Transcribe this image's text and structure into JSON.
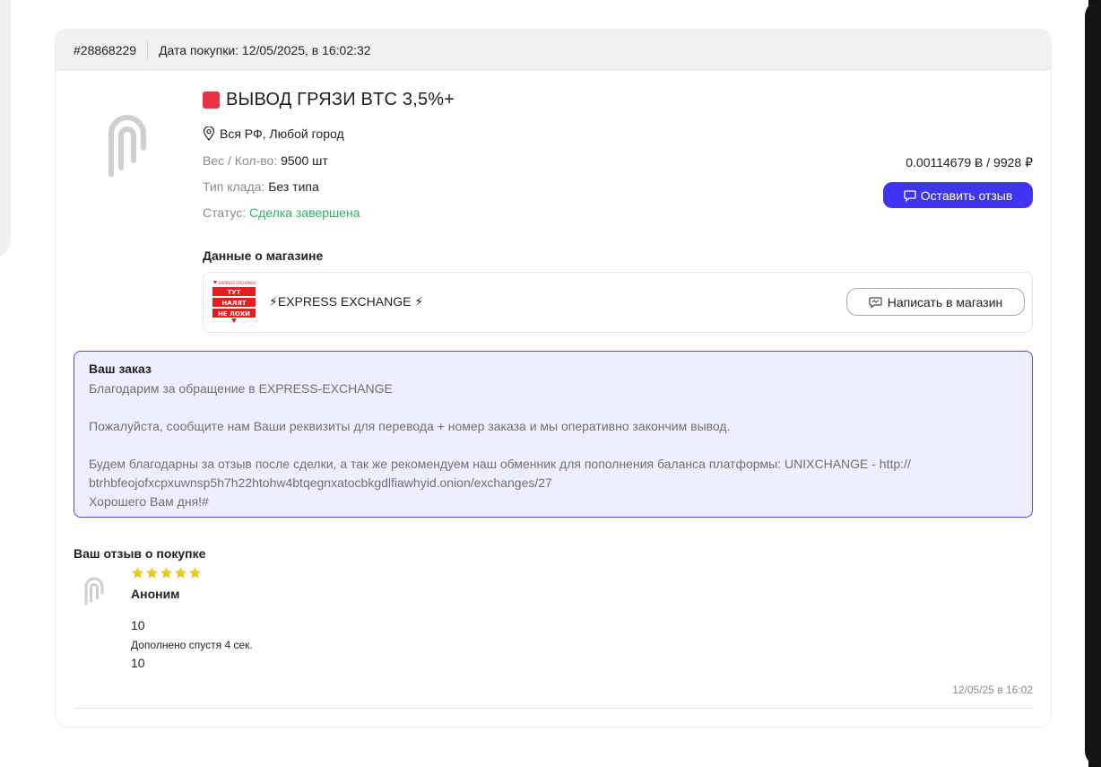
{
  "order": {
    "id": "#28868229",
    "purchase_date": "Дата покупки: 12/05/2025, в 16:02:32"
  },
  "product": {
    "title": "ВЫВОД ГРЯЗИ BTC 3,5%+",
    "location": "Вся РФ, Любой город",
    "weight_label": "Вес / Кол-во:",
    "weight_value": "9500 шт",
    "type_label": "Тип клада:",
    "type_value": "Без типа",
    "status_label": "Статус:",
    "status_value": "Сделка завершена",
    "price": "0.00114679 Ƀ / 9928 ₽",
    "review_button": "Оставить отзыв",
    "title_color": "#e63146",
    "status_color": "#2ab55d"
  },
  "shop": {
    "section_label": "Данные о магазине",
    "name": "⚡EXPRESS EXCHANGE ⚡",
    "write_button": "Написать в магазин",
    "logo_lines": [
      "EXPRESS EXCHANGE",
      "ТУТ",
      "НАЛЯТ",
      "НЕ ЛОХИ"
    ]
  },
  "order_message": {
    "title": "Ваш заказ",
    "lines": [
      "Благодарим за обращение в EXPRESS-EXCHANGE",
      "",
      "Пожалуйста, сообщите нам Ваши реквизиты для перевода + номер заказа и мы оперативно закончим вывод.",
      "",
      "Будем благодарны за отзыв после сделки, а так же рекомендуем наш обменник для пополнения баланса платформы: UNIXCHANGE - http://",
      "btrhbfeojofxcpxuwnsp5h7h22htohw4btqegnxatocbkgdlfiawhyid.onion/exchanges/27",
      "Хорошего Вам дня!#"
    ]
  },
  "feedback": {
    "section_label": "Ваш отзыв о покупке",
    "rating": 5,
    "author": "Аноним",
    "text": "10",
    "added_label": "Дополнено спустя 4 сек.",
    "added_text": "10",
    "date": "12/05/25 в 16:02"
  },
  "colors": {
    "accent": "#3f35f0",
    "star": "#f5c518",
    "order_box_bg": "#eeeffe"
  }
}
